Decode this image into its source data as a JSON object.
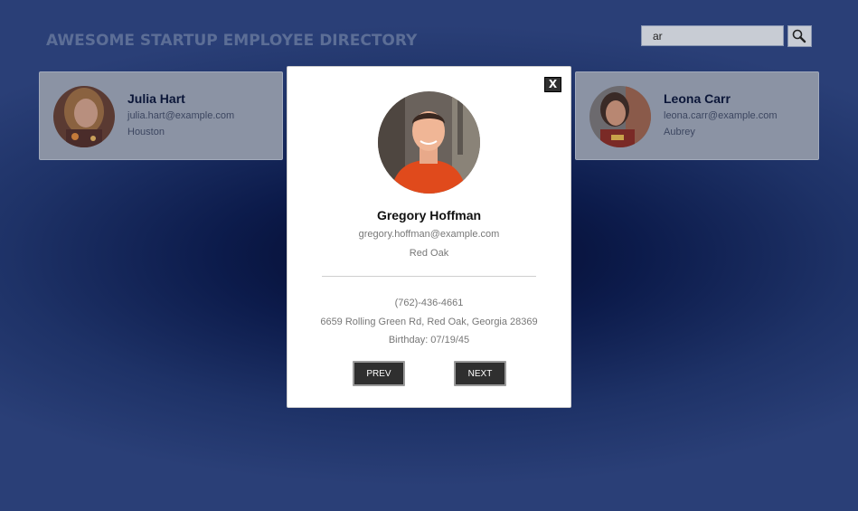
{
  "header": {
    "title": "AWESOME STARTUP EMPLOYEE DIRECTORY"
  },
  "search": {
    "value": "ar",
    "icon": "search-icon"
  },
  "cards": [
    {
      "name": "Julia Hart",
      "email": "julia.hart@example.com",
      "city": "Houston"
    },
    {
      "name": "Leona Carr",
      "email": "leona.carr@example.com",
      "city": "Aubrey"
    }
  ],
  "modal": {
    "close_label": "X",
    "name": "Gregory Hoffman",
    "email": "gregory.hoffman@example.com",
    "city": "Red Oak",
    "phone": "(762)-436-4661",
    "address": "6659 Rolling Green Rd, Red Oak, Georgia 28369",
    "birthday": "Birthday: 07/19/45",
    "prev_label": "PREV",
    "next_label": "NEXT"
  },
  "colors": {
    "overlay_dark": "#03092a",
    "overlay_light": "#2a3f77",
    "button_dark": "#2f2f2f",
    "modal_bg": "#ffffff"
  }
}
